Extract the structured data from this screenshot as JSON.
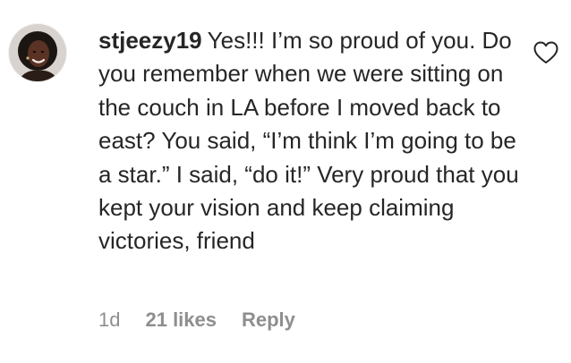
{
  "comment": {
    "username": "stjeezy19",
    "text": "Yes!!! I’m so proud of you. Do you remember when we were sitting on the couch in LA before I moved back to east? You said, “I’m think I’m going to be a star.” I said, “do it!” Very proud that you kept your vision and keep claiming victories, friend",
    "time": "1d",
    "likes": "21 likes",
    "reply_label": "Reply",
    "avatar_icon": "profile-photo",
    "like_icon": "heart-outline-icon"
  }
}
